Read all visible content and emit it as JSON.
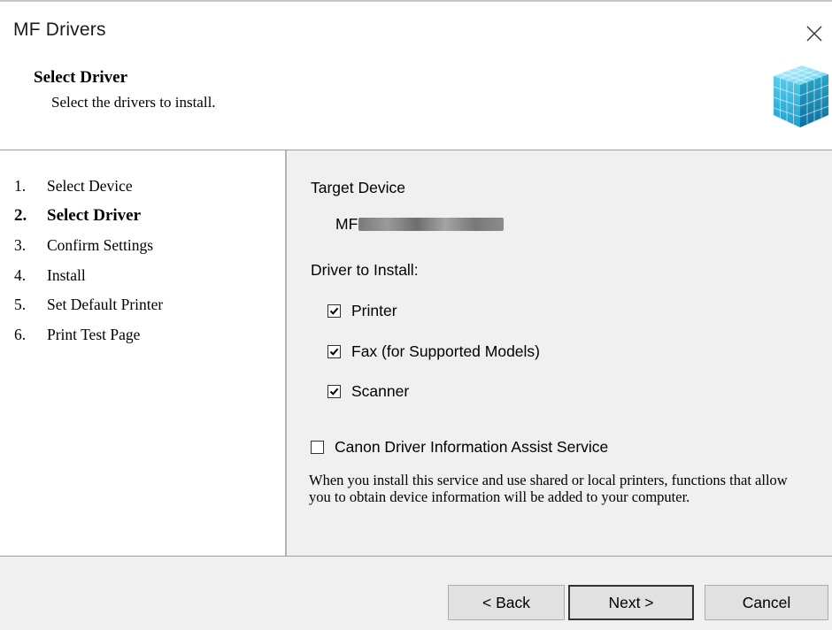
{
  "window": {
    "title": "MF Drivers",
    "close_icon": "close-icon"
  },
  "header": {
    "title": "Select Driver",
    "subtitle": "Select the drivers to install.",
    "logo_icon": "installer-cube-icon"
  },
  "steps": [
    {
      "number": "1.",
      "label": "Select Device",
      "active": false
    },
    {
      "number": "2.",
      "label": "Select Driver",
      "active": true
    },
    {
      "number": "3.",
      "label": "Confirm Settings",
      "active": false
    },
    {
      "number": "4.",
      "label": "Install",
      "active": false
    },
    {
      "number": "5.",
      "label": "Set Default Printer",
      "active": false
    },
    {
      "number": "6.",
      "label": "Print Test Page",
      "active": false
    }
  ],
  "content": {
    "target_device_label": "Target Device",
    "device_name_prefix": "MF",
    "device_name_redacted": true,
    "driver_label": "Driver to Install:",
    "drivers": [
      {
        "label": "Printer",
        "checked": true
      },
      {
        "label": "Fax (for Supported Models)",
        "checked": true
      },
      {
        "label": "Scanner",
        "checked": true
      }
    ],
    "assist_service": {
      "label": "Canon Driver Information Assist Service",
      "checked": false
    },
    "description": "When you install this service and use shared or local printers, functions that allow you to obtain device information will be added to your computer."
  },
  "footer": {
    "back_label": "< Back",
    "next_label": "Next >",
    "cancel_label": "Cancel"
  },
  "colors": {
    "panel_bg": "#f0f0f0",
    "button_bg": "#e1e1e1",
    "logo_accent": "#2aa7c9"
  }
}
